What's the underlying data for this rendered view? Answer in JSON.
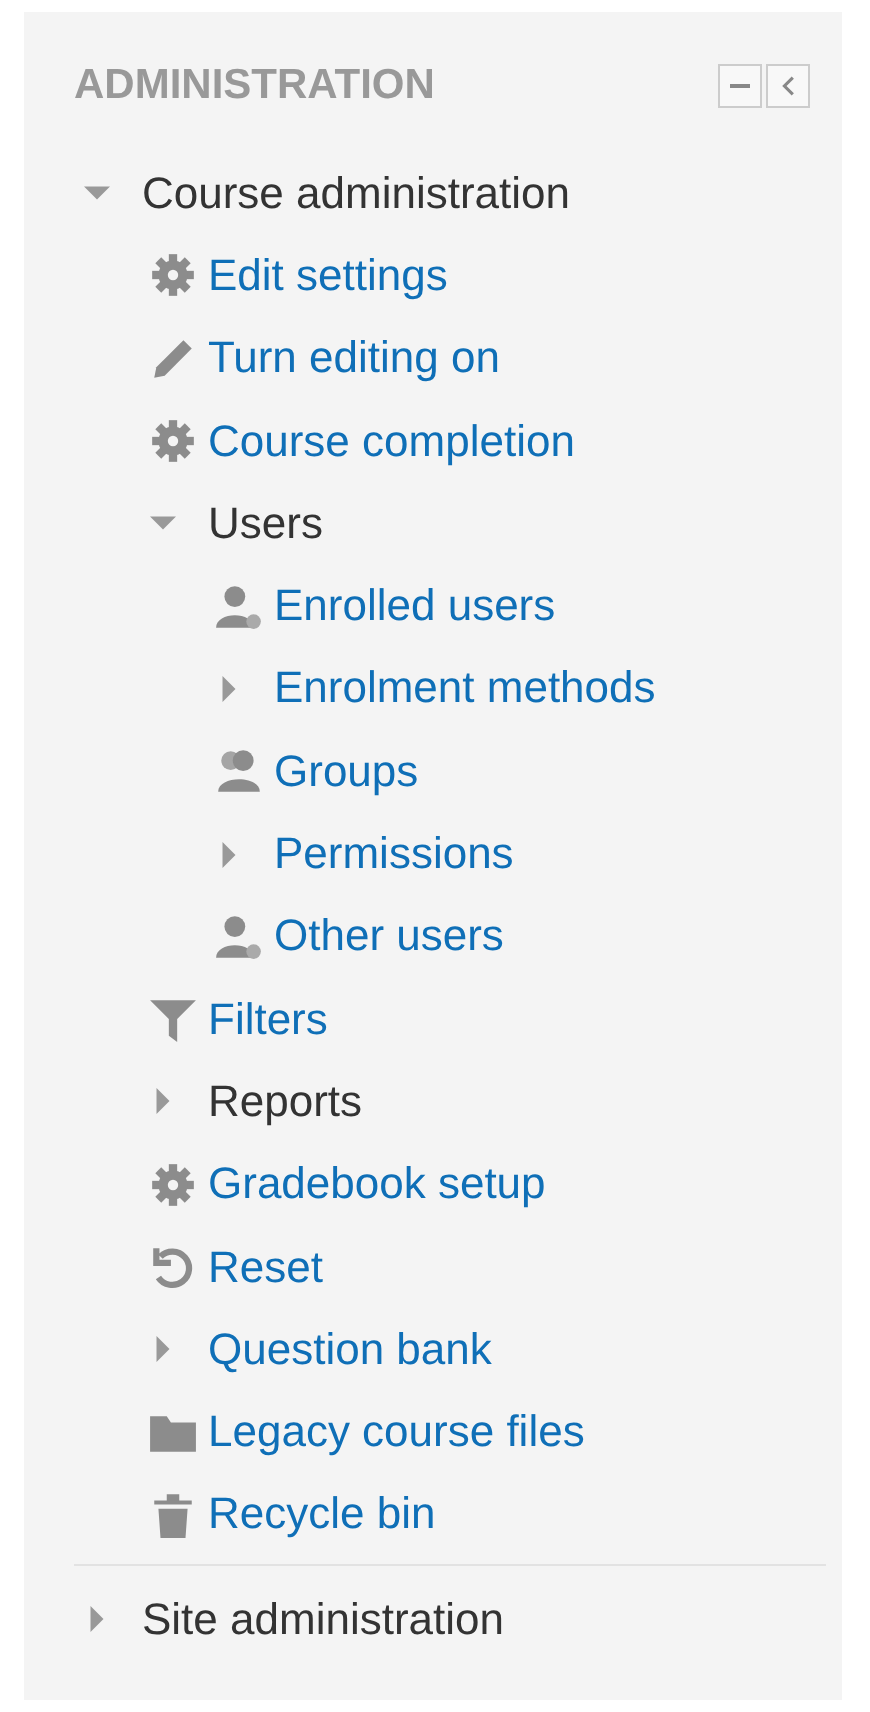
{
  "block": {
    "title": "ADMINISTRATION",
    "controls": [
      {
        "kind": "dock"
      },
      {
        "kind": "move"
      }
    ]
  },
  "tree": [
    {
      "label": "Course administration",
      "kind": "branch",
      "link": false,
      "expanded": true,
      "children": [
        {
          "label": "Edit settings",
          "kind": "settings"
        },
        {
          "label": "Turn editing on",
          "kind": "edit"
        },
        {
          "label": "Course completion",
          "kind": "settings"
        },
        {
          "label": "Users",
          "kind": "branch",
          "link": false,
          "expanded": true,
          "children": [
            {
              "label": "Enrolled users",
              "kind": "user"
            },
            {
              "label": "Enrolment methods",
              "kind": "branch",
              "link": true,
              "expanded": false
            },
            {
              "label": "Groups",
              "kind": "group"
            },
            {
              "label": "Permissions",
              "kind": "branch",
              "link": true,
              "expanded": false
            },
            {
              "label": "Other users",
              "kind": "user"
            }
          ]
        },
        {
          "label": "Filters",
          "kind": "filter"
        },
        {
          "label": "Reports",
          "kind": "branch",
          "link": false,
          "expanded": false
        },
        {
          "label": "Gradebook setup",
          "kind": "settings"
        },
        {
          "label": "Reset",
          "kind": "reset"
        },
        {
          "label": "Question bank",
          "kind": "branch",
          "link": true,
          "expanded": false
        },
        {
          "label": "Legacy course files",
          "kind": "folder"
        },
        {
          "label": "Recycle bin",
          "kind": "trash"
        }
      ]
    },
    {
      "label": "Site administration",
      "kind": "branch",
      "link": false,
      "expanded": false
    }
  ]
}
